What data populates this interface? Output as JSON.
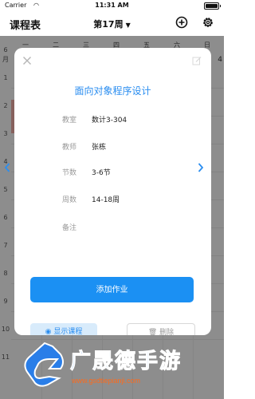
{
  "status_bar": {
    "carrier": "Carrier",
    "time": "11:31 AM"
  },
  "header": {
    "title": "课程表",
    "week_label": "第17周",
    "caret": "▼"
  },
  "timetable": {
    "weekdays": [
      "一",
      "二",
      "三",
      "四",
      "五",
      "六",
      "日"
    ],
    "month_label": "6\n月",
    "row_numbers": [
      "1",
      "2",
      "3",
      "4",
      "5",
      "6",
      "7",
      "8",
      "9",
      "10",
      "11"
    ],
    "edge_number": "4"
  },
  "course_dialog": {
    "course_name": "面向对象程序设计",
    "fields": [
      {
        "label": "教室",
        "value": "数计3-304"
      },
      {
        "label": "教师",
        "value": "张栋"
      },
      {
        "label": "节数",
        "value": "3-6节"
      },
      {
        "label": "周数",
        "value": "14-18周"
      },
      {
        "label": "备注",
        "value": ""
      }
    ],
    "add_homework_label": "添加作业",
    "secondary_label": "显示课程",
    "delete_label": "删除"
  },
  "watermark": {
    "brand": "广晟德手游",
    "url": "www.gsdtiepianji.com"
  },
  "colors": {
    "accent": "#1b90f3",
    "title_blue": "#2b8ef0",
    "course_strip": "#e9a8a0"
  }
}
